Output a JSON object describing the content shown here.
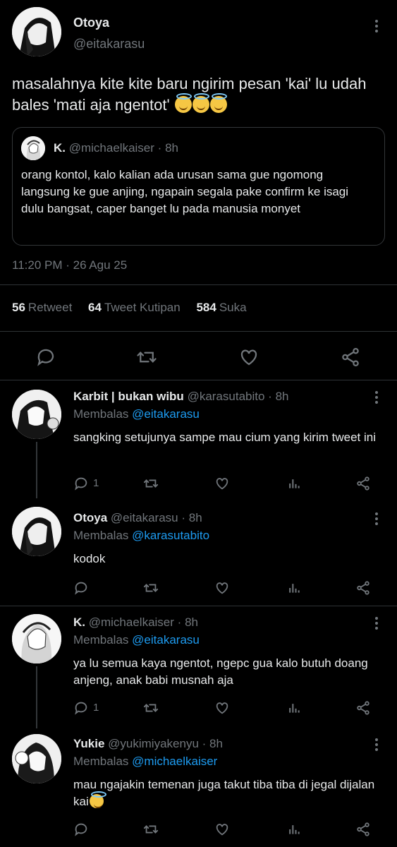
{
  "main_tweet": {
    "name": "Otoya",
    "handle": "@eitakarasu",
    "text": "masalahnya kite kite baru ngirim pesan 'kai' lu udah bales 'mati aja ngentot'",
    "emoji": "smiling-face-with-halo x3",
    "quote": {
      "name": "K.",
      "handle": "@michaelkaiser",
      "sep": "·",
      "time": "8h",
      "text": "orang kontol, kalo kalian ada urusan sama gue ngomong langsung ke gue anjing, ngapain segala pake confirm ke isagi dulu bangsat, caper banget lu pada manusia monyet"
    },
    "timestamp": "11:20 PM · 26 Agu 25",
    "stats": {
      "retweets": "56",
      "retweets_label": "Retweet",
      "quotes": "64",
      "quotes_label": "Tweet Kutipan",
      "likes": "584",
      "likes_label": "Suka"
    }
  },
  "replies": [
    {
      "name": "Karbit | bukan wibu",
      "handle": "@karasutabito",
      "time": "8h",
      "reply_prefix": "Membalas",
      "reply_to": "@eitakarasu",
      "text": "sangking setujunya sampe mau cium yang kirim tweet ini",
      "reply_count": "1"
    },
    {
      "name": "Otoya",
      "handle": "@eitakarasu",
      "time": "8h",
      "reply_prefix": "Membalas",
      "reply_to": "@karasutabito",
      "text": "kodok",
      "reply_count": ""
    },
    {
      "name": "K.",
      "handle": "@michaelkaiser",
      "time": "8h",
      "reply_prefix": "Membalas",
      "reply_to": "@eitakarasu",
      "text": "ya lu semua kaya ngentot, ngepc gua kalo butuh doang anjeng, anak babi musnah aja",
      "reply_count": "1"
    },
    {
      "name": "Yukie",
      "handle": "@yukimiyakenyu",
      "time": "8h",
      "reply_prefix": "Membalas",
      "reply_to": "@michaelkaiser",
      "text": "mau ngajakin temenan juga takut tiba tiba di jegal dijalan kai",
      "reply_count": ""
    }
  ],
  "sep": "·",
  "colors": {
    "background": "#000000",
    "text": "#e7e9ea",
    "muted": "#71767b",
    "link": "#1d9bf0",
    "border": "#2f3336"
  }
}
